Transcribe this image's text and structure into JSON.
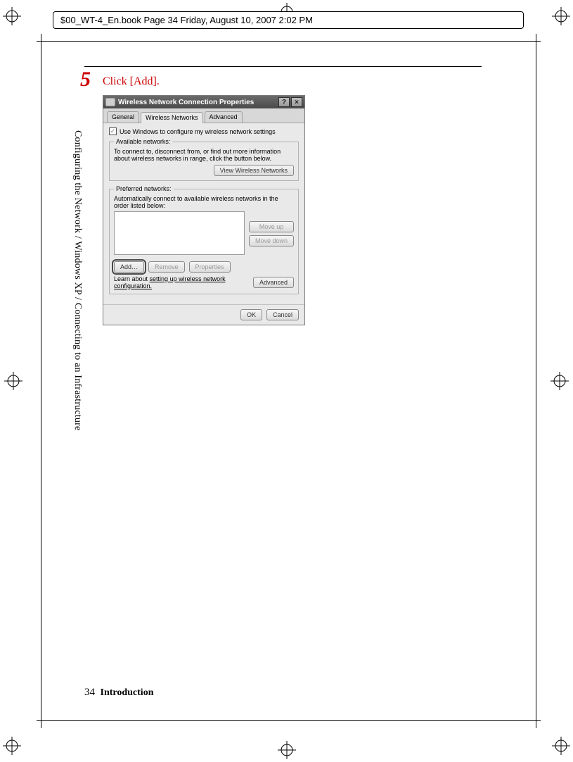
{
  "header": "$00_WT-4_En.book  Page 34  Friday, August 10, 2007  2:02 PM",
  "side_text": "Configuring the Network / Windows XP / Connecting to an Infrastructure",
  "footer": {
    "page_number": "34",
    "section": "Introduction"
  },
  "step": {
    "number": "5",
    "text": "Click [Add]."
  },
  "dialog": {
    "title": "Wireless Network Connection Properties",
    "help_btn": "?",
    "close_btn": "×",
    "tabs": {
      "general": "General",
      "wireless": "Wireless Networks",
      "advanced": "Advanced"
    },
    "use_windows_label": "Use Windows to configure my wireless network settings",
    "available": {
      "legend": "Available networks:",
      "hint": "To connect to, disconnect from, or find out more information about wireless networks in range, click the button below.",
      "view_btn": "View Wireless Networks"
    },
    "preferred": {
      "legend": "Preferred networks:",
      "hint": "Automatically connect to available wireless networks in the order listed below:",
      "move_up": "Move up",
      "move_down": "Move down",
      "add": "Add…",
      "remove": "Remove",
      "properties": "Properties",
      "learn_text": "Learn about ",
      "learn_link": "setting up wireless network configuration.",
      "advanced_btn": "Advanced"
    },
    "ok": "OK",
    "cancel": "Cancel"
  }
}
